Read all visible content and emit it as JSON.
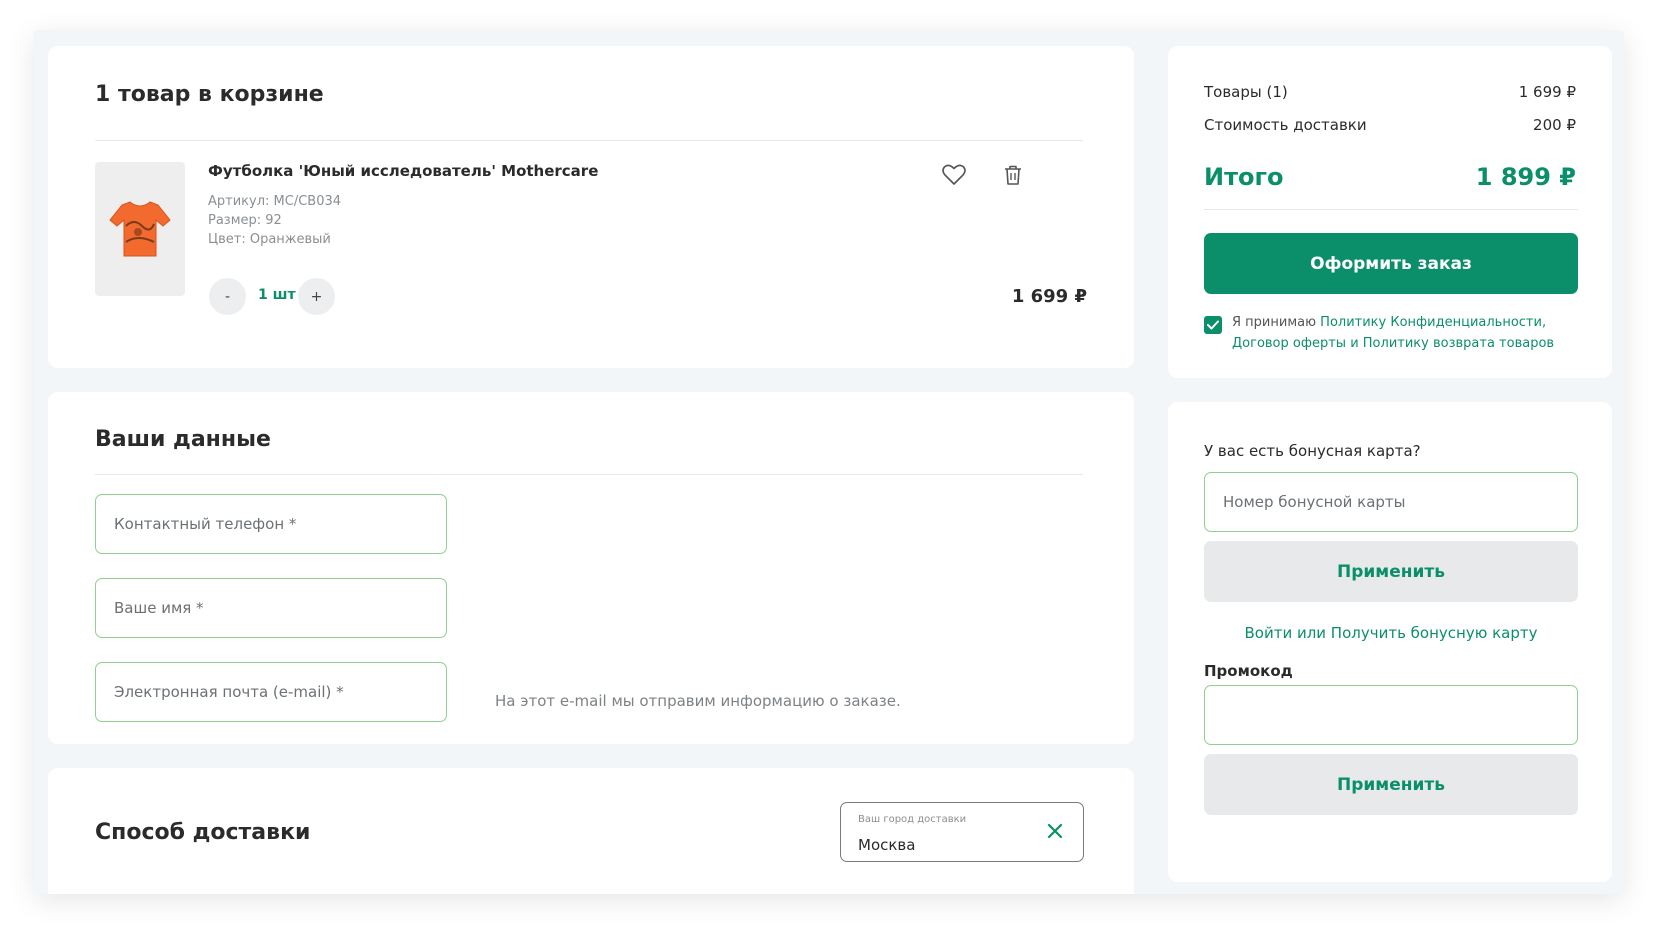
{
  "cart": {
    "title": "1 товар в корзине",
    "item": {
      "name": "Футболка 'Юный исследователь' Mothercare",
      "article": "Артикул: MC/CB034",
      "size": "Размер: 92",
      "color": "Цвет: Оранжевый",
      "qty_minus": "-",
      "qty": "1 шт",
      "qty_plus": "+",
      "price": "1 699 ₽",
      "icons": {
        "favorite": "heart-icon",
        "remove": "trash-icon",
        "image": "orange-tshirt"
      }
    }
  },
  "customer": {
    "title": "Ваши данные",
    "phone_placeholder": "Контактный телефон *",
    "name_placeholder": "Ваше имя *",
    "email_placeholder": "Электронная почта (e-mail) *",
    "email_hint": "На этот e-mail мы отправим информацию о заказе."
  },
  "delivery": {
    "title": "Способ доставки",
    "city_label": "Ваш город доставки",
    "city_value": "Москва",
    "clear_icon": "close-icon"
  },
  "summary": {
    "goods_label": "Товары (1)",
    "goods_value": "1 699 ₽",
    "shipping_label": "Стоимость доставки",
    "shipping_value": "200 ₽",
    "total_label": "Итого",
    "total_value": "1 899 ₽",
    "checkout_button": "Оформить заказ",
    "agree_prefix": "Я принимаю ",
    "agree_privacy": "Политику Конфиденциальности,",
    "agree_offer": "Договор оферты",
    "agree_and": " и ",
    "agree_return": "Политику возврата товаров",
    "agree_checked": true
  },
  "bonus": {
    "question": "У вас есть бонусная карта?",
    "card_placeholder": "Номер бонусной карты",
    "apply_button": "Применить",
    "login_link": "Войти или Получить бонусную карту",
    "promo_label": "Промокод",
    "promo_placeholder": "",
    "promo_apply_button": "Применить"
  },
  "colors": {
    "accent": "#0b8f6a",
    "field_border": "#8fcf8f",
    "background": "#f3f6f8",
    "product_orange": "#f26a2e"
  }
}
